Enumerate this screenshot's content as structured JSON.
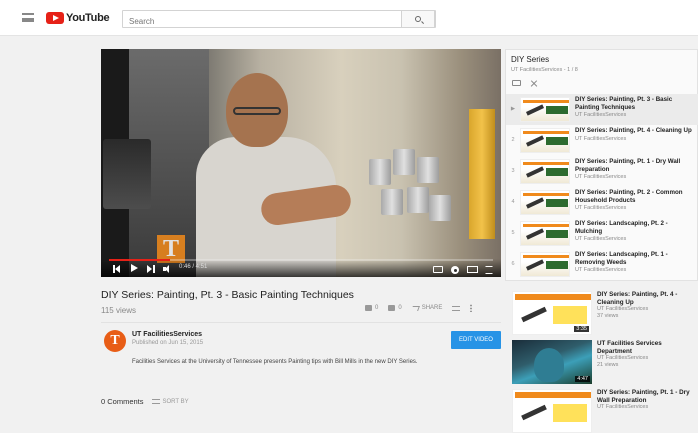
{
  "header": {
    "logo_text": "YouTube",
    "search_placeholder": "Search"
  },
  "player": {
    "time": "0:46 / 4:51",
    "progress_fraction": 0.16,
    "watermark": "T"
  },
  "video": {
    "title": "DIY Series: Painting, Pt. 3 - Basic Painting Techniques",
    "views": "115 views",
    "like_count": "0",
    "dislike_count": "0",
    "share_label": "SHARE",
    "channel_name": "UT FacilitiesServices",
    "published": "Published on Jun 15, 2015",
    "edit_button": "EDIT VIDEO",
    "description": "Facilities Services at the University of Tennessee presents Painting tips with Bill Mills in the new DIY Series.",
    "avatar_letter": "T"
  },
  "comments": {
    "count_label": "0 Comments",
    "sort_label": "SORT BY"
  },
  "playlist": {
    "title": "DIY Series",
    "subtitle": "UT FacilitiesServices - 1 / 8",
    "items": [
      {
        "index": "▶",
        "title": "DIY Series: Painting, Pt. 3 - Basic Painting Techniques",
        "channel": "UT FacilitiesServices"
      },
      {
        "index": "2",
        "title": "DIY Series: Painting, Pt. 4 - Cleaning Up",
        "channel": "UT FacilitiesServices"
      },
      {
        "index": "3",
        "title": "DIY Series: Painting, Pt. 1 - Dry Wall Preparation",
        "channel": "UT FacilitiesServices"
      },
      {
        "index": "4",
        "title": "DIY Series: Painting, Pt. 2 - Common Household Products",
        "channel": "UT FacilitiesServices"
      },
      {
        "index": "5",
        "title": "DIY Series: Landscaping, Pt. 2 - Mulching",
        "channel": "UT FacilitiesServices"
      },
      {
        "index": "6",
        "title": "DIY Series: Landscaping, Pt. 1 - Removing Weeds",
        "channel": "UT FacilitiesServices"
      }
    ]
  },
  "recommended": [
    {
      "title": "DIY Series: Painting, Pt. 4 - Cleaning Up",
      "channel": "UT FacilitiesServices",
      "views": "37 views",
      "duration": "3:35",
      "thumb_caption": "FACILITIES DIY SERIES"
    },
    {
      "title": "UT Facilities Services Department",
      "channel": "UT FacilitiesServices",
      "views": "21 views",
      "duration": "4:47",
      "thumb_caption": ""
    },
    {
      "title": "DIY Series: Painting, Pt. 1 - Dry Wall Preparation",
      "channel": "UT FacilitiesServices",
      "views": "",
      "duration": "",
      "thumb_caption": "FACILITIES DIY SERIES"
    }
  ]
}
